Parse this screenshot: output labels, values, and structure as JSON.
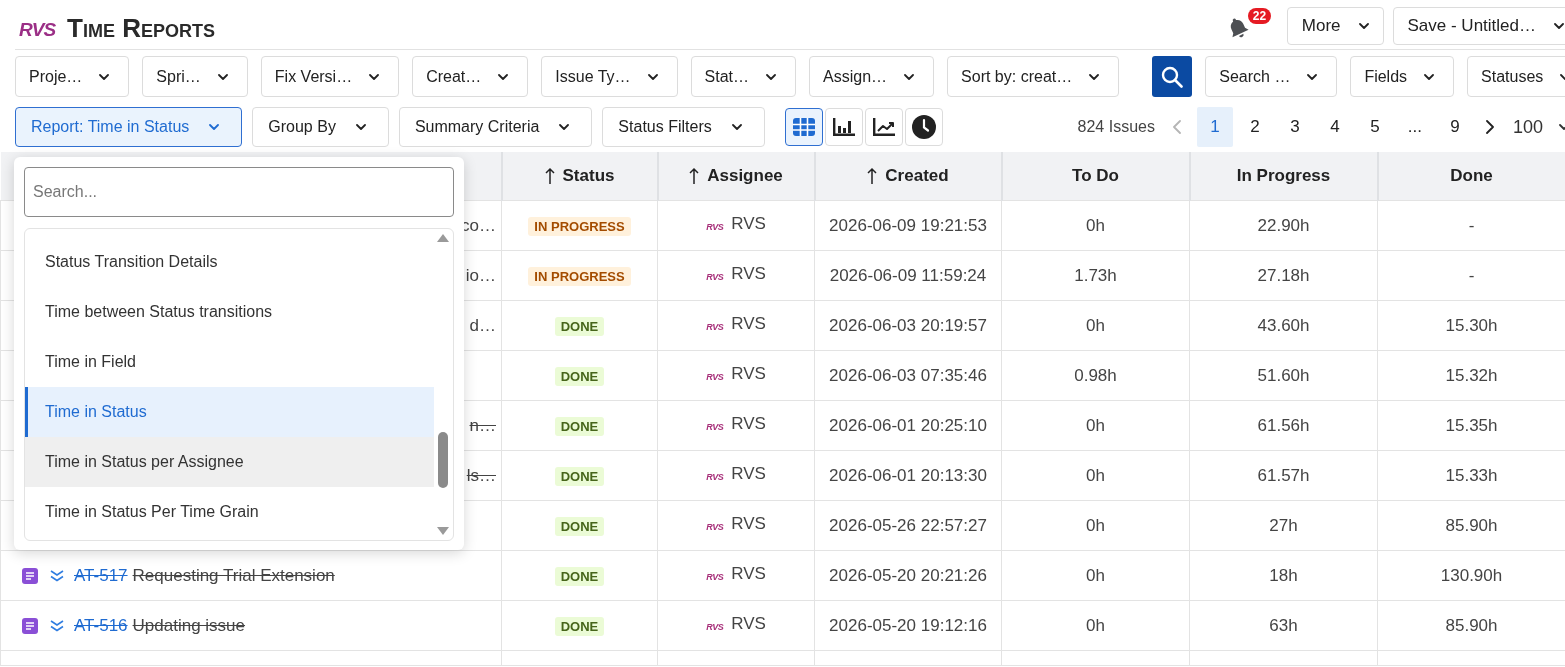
{
  "header": {
    "logo": "RVS",
    "title": "Time Reports",
    "notifications": {
      "count": "22"
    },
    "actions": [
      {
        "label": "More"
      },
      {
        "label": "Save - Untitled…"
      }
    ]
  },
  "filters": [
    {
      "kind": "dropdown",
      "label": "Proje…"
    },
    {
      "kind": "dropdown",
      "label": "Spri…"
    },
    {
      "kind": "dropdown",
      "label": "Fix Versi…"
    },
    {
      "kind": "dropdown",
      "label": "Creat…"
    },
    {
      "kind": "dropdown",
      "label": "Issue Ty…"
    },
    {
      "kind": "dropdown",
      "label": "Stat…"
    },
    {
      "kind": "dropdown",
      "label": "Assign…"
    },
    {
      "kind": "dropdown",
      "label": "Sort by: creat…"
    },
    {
      "kind": "search"
    },
    {
      "kind": "dropdown",
      "label": "Search …"
    },
    {
      "kind": "dropdown",
      "label": "Fields"
    },
    {
      "kind": "dropdown",
      "label": "Statuses"
    }
  ],
  "report_bar": {
    "options": [
      {
        "label": "Report: Time in Status",
        "selected": true
      },
      {
        "label": "Group By",
        "selected": false
      },
      {
        "label": "Summary Criteria",
        "selected": false
      },
      {
        "label": "Status Filters",
        "selected": false
      }
    ],
    "views": [
      {
        "kind": "table",
        "selected": true
      },
      {
        "kind": "bar_chart",
        "selected": false
      },
      {
        "kind": "line_chart",
        "selected": false
      },
      {
        "kind": "clock",
        "selected": false
      }
    ],
    "pagination": {
      "count": "824 Issues",
      "previous_disabled": true,
      "pages": [
        {
          "label": "1",
          "selected": true
        },
        {
          "label": "2",
          "selected": false
        },
        {
          "label": "3",
          "selected": false
        },
        {
          "label": "4",
          "selected": false
        },
        {
          "label": "5",
          "selected": false
        },
        {
          "label": "...",
          "selected": false
        },
        {
          "label": "9",
          "selected": false
        }
      ],
      "next_disabled": false,
      "page_size": "100"
    }
  },
  "report_menu": {
    "search": {
      "placeholder": "Search..."
    },
    "items": [
      {
        "label": "Status Transition Details",
        "selected": false,
        "hovered": false
      },
      {
        "label": "Time between Status transitions",
        "selected": false,
        "hovered": false
      },
      {
        "label": "Time in Field",
        "selected": false,
        "hovered": false
      },
      {
        "label": "Time in Status",
        "selected": true,
        "hovered": false
      },
      {
        "label": "Time in Status per Assignee",
        "selected": false,
        "hovered": true
      },
      {
        "label": "Time in Status Per Time Grain",
        "selected": false,
        "hovered": false
      }
    ]
  },
  "table": {
    "columns": [
      {
        "label": "Status",
        "sorted": true
      },
      {
        "label": "Assignee",
        "sorted": true
      },
      {
        "label": "Created",
        "sorted": true
      },
      {
        "label": "To Do",
        "sorted": false
      },
      {
        "label": "In Progress",
        "sorted": false
      },
      {
        "label": "Done",
        "sorted": false
      }
    ],
    "rows": [
      {
        "issue": {
          "tail": "co…",
          "struck": false
        },
        "status": {
          "kind": "in_progress",
          "label": "IN PROGRESS"
        },
        "assignee": {
          "avatar": "RVS",
          "name": "RVS"
        },
        "created": "2026-06-09 19:21:53",
        "to_do": "0h",
        "in_progress": "22.90h",
        "done": "-"
      },
      {
        "issue": {
          "tail": "io…",
          "struck": false
        },
        "status": {
          "kind": "in_progress",
          "label": "IN PROGRESS"
        },
        "assignee": {
          "avatar": "RVS",
          "name": "RVS"
        },
        "created": "2026-06-09 11:59:24",
        "to_do": "1.73h",
        "in_progress": "27.18h",
        "done": "-"
      },
      {
        "issue": {
          "tail": "d…",
          "struck": false
        },
        "status": {
          "kind": "done",
          "label": "DONE"
        },
        "assignee": {
          "avatar": "RVS",
          "name": "RVS"
        },
        "created": "2026-06-03 20:19:57",
        "to_do": "0h",
        "in_progress": "43.60h",
        "done": "15.30h"
      },
      {
        "status": {
          "kind": "done",
          "label": "DONE"
        },
        "assignee": {
          "avatar": "RVS",
          "name": "RVS"
        },
        "created": "2026-06-03 07:35:46",
        "to_do": "0.98h",
        "in_progress": "51.60h",
        "done": "15.32h"
      },
      {
        "issue": {
          "tail": "n…",
          "struck": true
        },
        "status": {
          "kind": "done",
          "label": "DONE"
        },
        "assignee": {
          "avatar": "RVS",
          "name": "RVS"
        },
        "created": "2026-06-01 20:25:10",
        "to_do": "0h",
        "in_progress": "61.56h",
        "done": "15.35h"
      },
      {
        "issue": {
          "tail": "ls…",
          "struck": true
        },
        "status": {
          "kind": "done",
          "label": "DONE"
        },
        "assignee": {
          "avatar": "RVS",
          "name": "RVS"
        },
        "created": "2026-06-01 20:13:30",
        "to_do": "0h",
        "in_progress": "61.57h",
        "done": "15.33h"
      },
      {
        "status": {
          "kind": "done",
          "label": "DONE"
        },
        "assignee": {
          "avatar": "RVS",
          "name": "RVS"
        },
        "created": "2026-05-26 22:57:27",
        "to_do": "0h",
        "in_progress": "27h",
        "done": "85.90h"
      },
      {
        "issue": {
          "key": "AT-517",
          "summary": "Requesting Trial Extension",
          "priority": {
            "kind": "low"
          },
          "struck": true
        },
        "status": {
          "kind": "done",
          "label": "DONE"
        },
        "assignee": {
          "avatar": "RVS",
          "name": "RVS"
        },
        "created": "2026-05-20 20:21:26",
        "to_do": "0h",
        "in_progress": "18h",
        "done": "130.90h"
      },
      {
        "issue": {
          "key": "AT-516",
          "summary": "Updating issue",
          "priority": {
            "kind": "low"
          },
          "struck": true
        },
        "status": {
          "kind": "done",
          "label": "DONE"
        },
        "assignee": {
          "avatar": "RVS",
          "name": "RVS"
        },
        "created": "2026-05-20 19:12:16",
        "to_do": "0h",
        "in_progress": "63h",
        "done": "85.90h"
      }
    ]
  }
}
